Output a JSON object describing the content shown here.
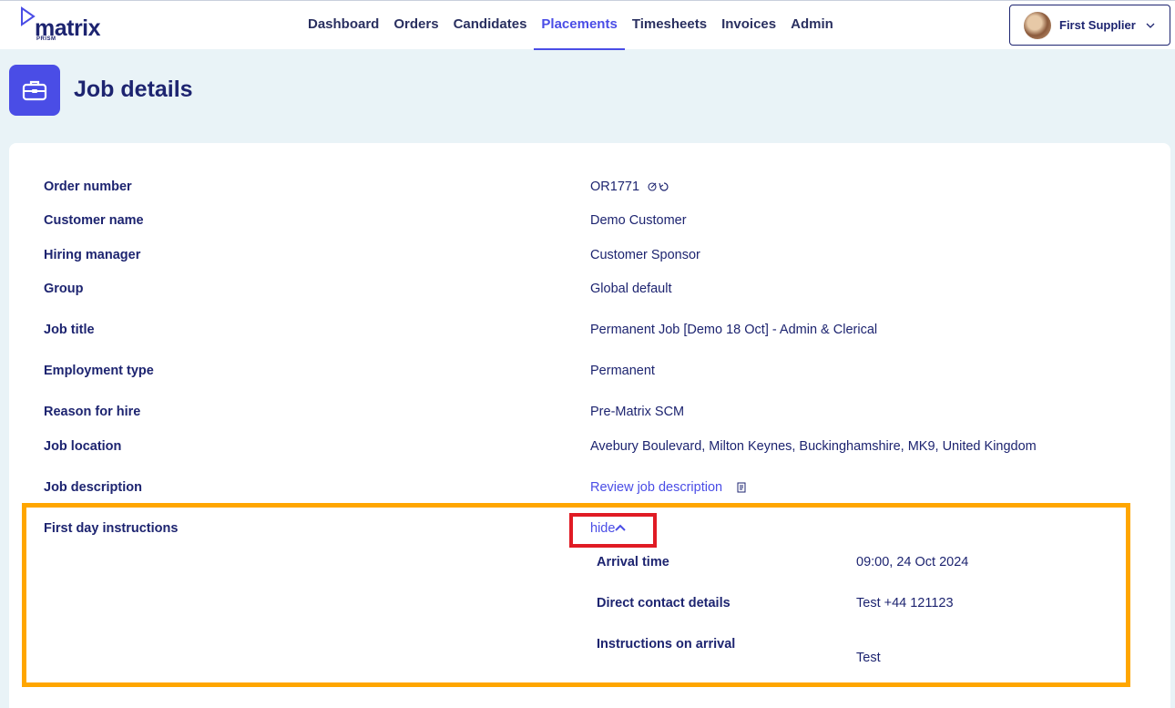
{
  "brand": {
    "name": "matrix",
    "sub": "PRISM"
  },
  "nav": {
    "items": [
      "Dashboard",
      "Orders",
      "Candidates",
      "Placements",
      "Timesheets",
      "Invoices",
      "Admin"
    ],
    "active": "Placements"
  },
  "user": {
    "name": "First Supplier"
  },
  "page": {
    "title": "Job details",
    "icon": "briefcase-icon"
  },
  "details": {
    "order_number": {
      "label": "Order number",
      "value": "OR1771"
    },
    "customer_name": {
      "label": "Customer name",
      "value": "Demo Customer"
    },
    "hiring_manager": {
      "label": "Hiring manager",
      "value": "Customer Sponsor"
    },
    "group": {
      "label": "Group",
      "value": "Global default"
    },
    "job_title": {
      "label": "Job title",
      "value": "Permanent Job [Demo 18 Oct] - Admin & Clerical"
    },
    "employment_type": {
      "label": "Employment type",
      "value": "Permanent"
    },
    "reason_for_hire": {
      "label": "Reason for hire",
      "value": "Pre-Matrix SCM"
    },
    "job_location": {
      "label": "Job location",
      "value": "Avebury Boulevard, Milton Keynes, Buckinghamshire, MK9, United Kingdom"
    },
    "job_description": {
      "label": "Job description",
      "link": "Review job description"
    },
    "first_day": {
      "label": "First day instructions",
      "toggle": "hide",
      "arrival_time": {
        "label": "Arrival time",
        "value": "09:00, 24 Oct 2024"
      },
      "direct_contact": {
        "label": "Direct contact details",
        "value": "Test +44 121123"
      },
      "instructions": {
        "label": "Instructions on arrival",
        "value": "Test"
      }
    }
  },
  "colors": {
    "accent": "#4a4de6",
    "text": "#1d2470",
    "background": "#e9f3f7",
    "highlight_orange": "#ffa600",
    "highlight_red": "#e01b24"
  }
}
